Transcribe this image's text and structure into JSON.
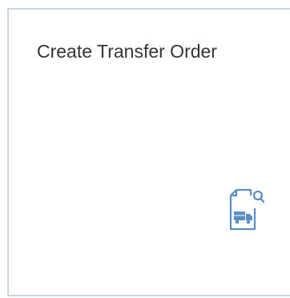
{
  "tile": {
    "title": "Create Transfer Order",
    "icon": "document-truck-search-icon",
    "icon_color": "#5a8ec5",
    "border_color": "#c9d5e3",
    "text_color": "#32363a"
  }
}
